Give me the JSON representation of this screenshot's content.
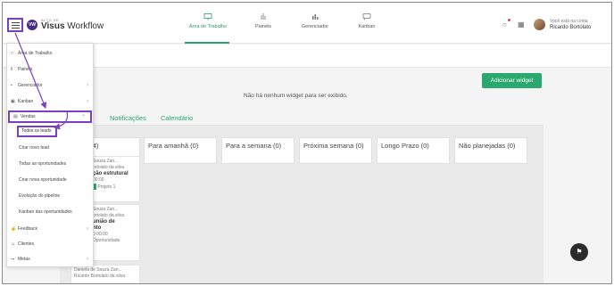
{
  "brand": {
    "small": "ALTO SE",
    "name_bold": "Visus",
    "name_rest": " Workflow",
    "mark": "VW"
  },
  "nav": [
    {
      "label": "Área de Trabalho",
      "icon": "monitor-icon"
    },
    {
      "label": "Painéis",
      "icon": "bar-chart-icon"
    },
    {
      "label": "Gerenciador",
      "icon": "stats-icon"
    },
    {
      "label": "Kanban",
      "icon": "chat-icon"
    }
  ],
  "user": {
    "greeting": "Você está na conta",
    "name": "Ricardo Bortolato"
  },
  "actions": {
    "add_widget": "Adicionar widget"
  },
  "empty_message": "Não há nenhum widget para ser exibido.",
  "tabs": [
    "Notificações",
    "Calendário"
  ],
  "columns": [
    {
      "label": "e (4)"
    },
    {
      "label": "Para amanhã (0)"
    },
    {
      "label": "Para a semana (0)"
    },
    {
      "label": "Próxima semana (0)"
    },
    {
      "label": "Longo Prazo (0)"
    },
    {
      "label": "Não planejadas (0)"
    }
  ],
  "cards": [
    {
      "owner": "Souza Zan...",
      "sub": "ortolato da silva",
      "title": "ção estrutural",
      "time": "00:00",
      "tag": "Projeto 1"
    },
    {
      "owner": "Souza Zan...",
      "sub": "ortolato da silva",
      "title": "união de",
      "title2": "nto",
      "time": "0 00:00",
      "tag": "Oportunidade"
    },
    {
      "owner": "Daniela de Souza Zan...",
      "sub": "Ricardo Bortolato da silva"
    }
  ],
  "sidebar": {
    "items": [
      {
        "label": "Área de Trabalho",
        "icon": "monitor-icon"
      },
      {
        "label": "Painéis",
        "icon": "bar-chart-icon"
      },
      {
        "label": "Gerenciador",
        "icon": "stats-icon"
      },
      {
        "label": "Kanban",
        "icon": "chat-icon"
      },
      {
        "label": "Vendas",
        "icon": "cart-icon"
      }
    ],
    "vendas_sub": [
      "Todos os leads",
      "Criar novo lead",
      "Todas as oportunidades",
      "Criar nova oportunidade",
      "Evolução do pipeline",
      "Kanban das oportunidades"
    ],
    "bottom": [
      {
        "label": "Feedback",
        "icon": "thumb-icon"
      },
      {
        "label": "Clientes",
        "icon": "users-icon"
      },
      {
        "label": "Metas",
        "icon": "trend-icon"
      }
    ]
  },
  "colors": {
    "accent": "#2aa86e",
    "highlight": "#7b3fc4"
  }
}
